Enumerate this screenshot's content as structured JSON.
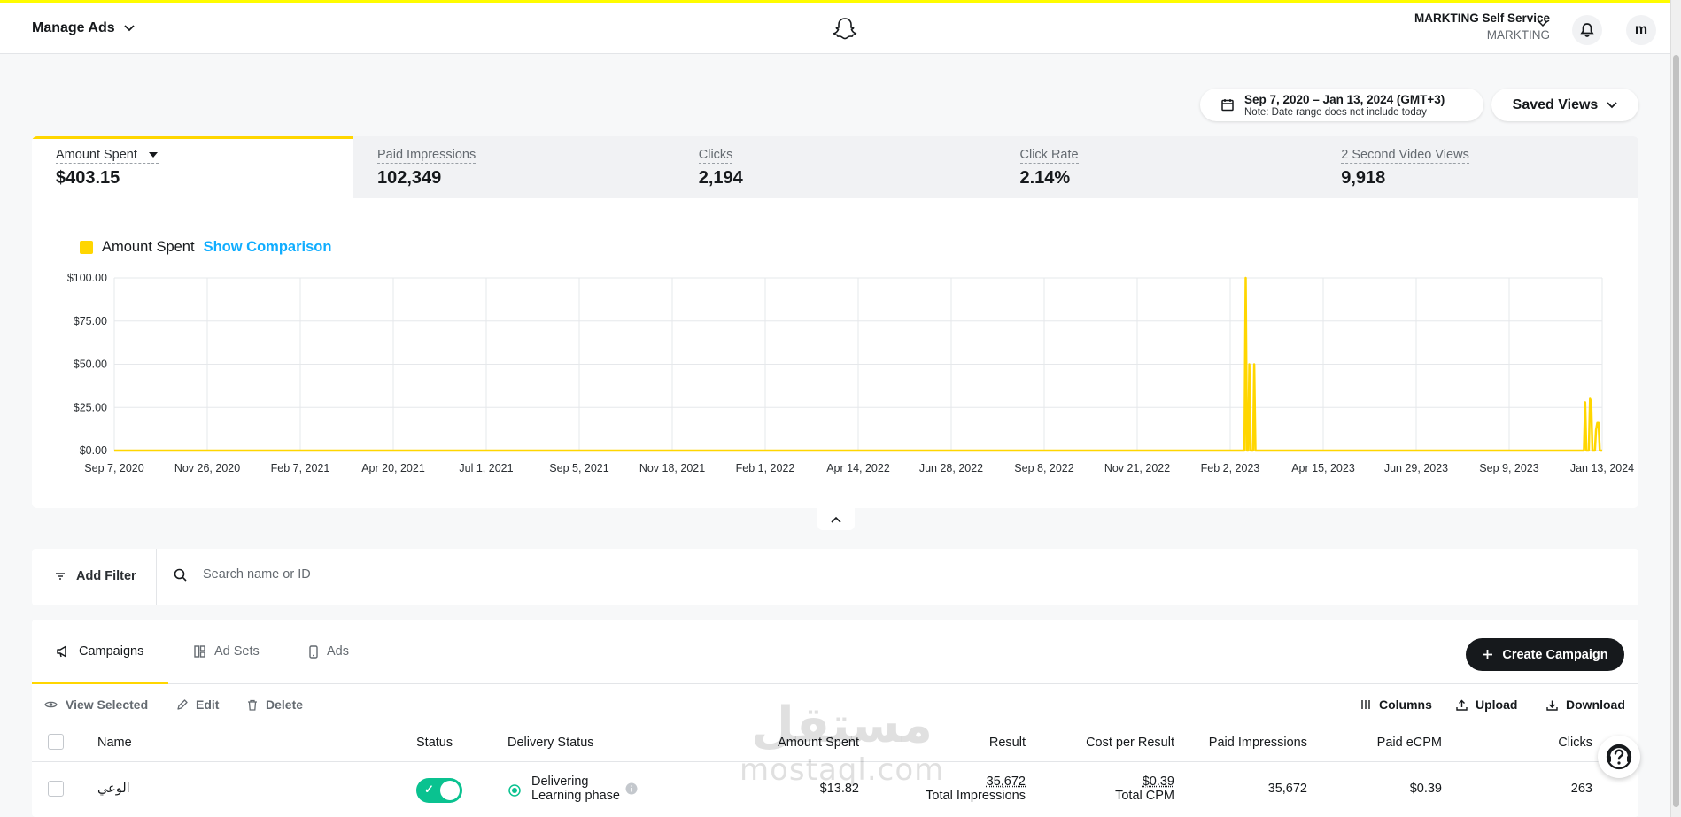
{
  "header": {
    "title": "Manage Ads",
    "account_name": "MARKTING Self Service",
    "account_org": "MARKTING",
    "avatar_initial": "m"
  },
  "date_range": {
    "label": "Sep 7, 2020 – Jan 13, 2024 (GMT+3)",
    "note": "Note: Date range does not include today"
  },
  "saved_views": "Saved Views",
  "metrics": [
    {
      "label": "Amount Spent",
      "value": "$403.15"
    },
    {
      "label": "Paid Impressions",
      "value": "102,349"
    },
    {
      "label": "Clicks",
      "value": "2,194"
    },
    {
      "label": "Click Rate",
      "value": "2.14%"
    },
    {
      "label": "2 Second Video Views",
      "value": "9,918"
    }
  ],
  "legend": {
    "series": "Amount Spent",
    "comparison": "Show Comparison"
  },
  "chart_data": {
    "type": "line",
    "series": [
      {
        "name": "Amount Spent",
        "color": "#ffd600"
      }
    ],
    "y_ticks": [
      "$100.00",
      "$75.00",
      "$50.00",
      "$25.00",
      "$0.00"
    ],
    "x_ticks": [
      "Sep 7, 2020",
      "Nov 26, 2020",
      "Feb 7, 2021",
      "Apr 20, 2021",
      "Jul 1, 2021",
      "Sep 5, 2021",
      "Nov 18, 2021",
      "Feb 1, 2022",
      "Apr 14, 2022",
      "Jun 28, 2022",
      "Sep 8, 2022",
      "Nov 21, 2022",
      "Feb 2, 2023",
      "Apr 15, 2023",
      "Jun 29, 2023",
      "Sep 9, 2023",
      "Jan 13, 2024"
    ],
    "ylim": [
      0,
      100
    ],
    "x": [
      "2020-09-07",
      "2023-03-25",
      "2023-03-26",
      "2023-03-27",
      "2023-03-28",
      "2023-03-29",
      "2023-03-30",
      "2023-03-31",
      "2023-04-01",
      "2023-04-02",
      "2023-04-03",
      "2023-04-04",
      "2023-04-05",
      "2023-04-06",
      "2023-12-28",
      "2023-12-29",
      "2023-12-30",
      "2023-12-31",
      "2024-01-01",
      "2024-01-02",
      "2024-01-03",
      "2024-01-04",
      "2024-01-05",
      "2024-01-06",
      "2024-01-07",
      "2024-01-08",
      "2024-01-09",
      "2024-01-10",
      "2024-01-11",
      "2024-01-12",
      "2024-01-13"
    ],
    "values": [
      0,
      0,
      100,
      0,
      0,
      50,
      0,
      0,
      0,
      50,
      0,
      0,
      0,
      0,
      0,
      0,
      28,
      0,
      0,
      0,
      30,
      28,
      0,
      0,
      0,
      12,
      16,
      16,
      0,
      0,
      0
    ],
    "grid": true
  },
  "filter": {
    "add_filter": "Add Filter",
    "search_placeholder": "Search name or ID"
  },
  "tabs": [
    "Campaigns",
    "Ad Sets",
    "Ads"
  ],
  "create_campaign": "Create Campaign",
  "toolbar": {
    "view_selected": "View Selected",
    "edit": "Edit",
    "delete": "Delete",
    "columns": "Columns",
    "upload": "Upload",
    "download": "Download"
  },
  "table": {
    "headers": [
      "Name",
      "Status",
      "Delivery Status",
      "Amount Spent",
      "Result",
      "Cost per Result",
      "Paid Impressions",
      "Paid eCPM",
      "Clicks"
    ],
    "rows": [
      {
        "name": "الوعي",
        "delivery_status": "Delivering",
        "delivery_sub": "Learning phase",
        "amount_spent": "$13.82",
        "result": "35,672",
        "result_sub": "Total Impressions",
        "cost_per_result": "$0.39",
        "cost_sub": "Total CPM",
        "paid_impressions": "35,672",
        "paid_ecpm": "$0.39",
        "clicks": "263"
      }
    ]
  },
  "watermark": {
    "arabic": "مستقل",
    "latin": "mostaql.com"
  }
}
